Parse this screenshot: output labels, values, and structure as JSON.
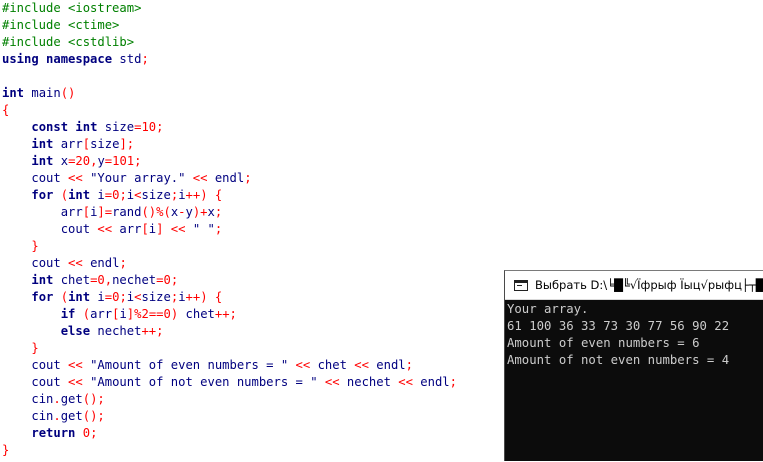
{
  "editor": {
    "lines": [
      [
        {
          "t": "#include <iostream>",
          "c": "pp"
        }
      ],
      [
        {
          "t": "#include <ctime>",
          "c": "pp"
        }
      ],
      [
        {
          "t": "#include <cstdlib>",
          "c": "pp"
        }
      ],
      [
        {
          "t": "using",
          "c": "kw"
        },
        {
          "t": " ",
          "c": ""
        },
        {
          "t": "namespace",
          "c": "kw"
        },
        {
          "t": " std",
          "c": "id"
        },
        {
          "t": ";",
          "c": "op"
        }
      ],
      [],
      [
        {
          "t": "int",
          "c": "kw"
        },
        {
          "t": " main",
          "c": "id"
        },
        {
          "t": "()",
          "c": "op"
        }
      ],
      [
        {
          "t": "{",
          "c": "op"
        }
      ],
      [
        {
          "t": "    ",
          "c": ""
        },
        {
          "t": "const",
          "c": "kw"
        },
        {
          "t": " ",
          "c": ""
        },
        {
          "t": "int",
          "c": "kw"
        },
        {
          "t": " size",
          "c": "id"
        },
        {
          "t": "=",
          "c": "op"
        },
        {
          "t": "10",
          "c": "num"
        },
        {
          "t": ";",
          "c": "op"
        }
      ],
      [
        {
          "t": "    ",
          "c": ""
        },
        {
          "t": "int",
          "c": "kw"
        },
        {
          "t": " arr",
          "c": "id"
        },
        {
          "t": "[",
          "c": "op"
        },
        {
          "t": "size",
          "c": "id"
        },
        {
          "t": "];",
          "c": "op"
        }
      ],
      [
        {
          "t": "    ",
          "c": ""
        },
        {
          "t": "int",
          "c": "kw"
        },
        {
          "t": " x",
          "c": "id"
        },
        {
          "t": "=",
          "c": "op"
        },
        {
          "t": "20",
          "c": "num"
        },
        {
          "t": ",",
          "c": "op"
        },
        {
          "t": "y",
          "c": "id"
        },
        {
          "t": "=",
          "c": "op"
        },
        {
          "t": "101",
          "c": "num"
        },
        {
          "t": ";",
          "c": "op"
        }
      ],
      [
        {
          "t": "    ",
          "c": ""
        },
        {
          "t": "cout",
          "c": "id"
        },
        {
          "t": " << ",
          "c": "op"
        },
        {
          "t": "\"Your array.\"",
          "c": "str"
        },
        {
          "t": " << ",
          "c": "op"
        },
        {
          "t": "endl",
          "c": "id"
        },
        {
          "t": ";",
          "c": "op"
        }
      ],
      [
        {
          "t": "    ",
          "c": ""
        },
        {
          "t": "for",
          "c": "kw"
        },
        {
          "t": " (",
          "c": "op"
        },
        {
          "t": "int",
          "c": "kw"
        },
        {
          "t": " i",
          "c": "id"
        },
        {
          "t": "=",
          "c": "op"
        },
        {
          "t": "0",
          "c": "num"
        },
        {
          "t": ";",
          "c": "op"
        },
        {
          "t": "i",
          "c": "id"
        },
        {
          "t": "<",
          "c": "op"
        },
        {
          "t": "size",
          "c": "id"
        },
        {
          "t": ";",
          "c": "op"
        },
        {
          "t": "i",
          "c": "id"
        },
        {
          "t": "++) {",
          "c": "op"
        }
      ],
      [
        {
          "t": "        ",
          "c": ""
        },
        {
          "t": "arr",
          "c": "id"
        },
        {
          "t": "[",
          "c": "op"
        },
        {
          "t": "i",
          "c": "id"
        },
        {
          "t": "]=",
          "c": "op"
        },
        {
          "t": "rand",
          "c": "id"
        },
        {
          "t": "()%(",
          "c": "op"
        },
        {
          "t": "x",
          "c": "id"
        },
        {
          "t": "-",
          "c": "op"
        },
        {
          "t": "y",
          "c": "id"
        },
        {
          "t": ")+",
          "c": "op"
        },
        {
          "t": "x",
          "c": "id"
        },
        {
          "t": ";",
          "c": "op"
        }
      ],
      [
        {
          "t": "        ",
          "c": ""
        },
        {
          "t": "cout",
          "c": "id"
        },
        {
          "t": " << ",
          "c": "op"
        },
        {
          "t": "arr",
          "c": "id"
        },
        {
          "t": "[",
          "c": "op"
        },
        {
          "t": "i",
          "c": "id"
        },
        {
          "t": "]",
          "c": "op"
        },
        {
          "t": " << ",
          "c": "op"
        },
        {
          "t": "\" \"",
          "c": "str"
        },
        {
          "t": ";",
          "c": "op"
        }
      ],
      [
        {
          "t": "    ",
          "c": ""
        },
        {
          "t": "}",
          "c": "op"
        }
      ],
      [
        {
          "t": "    ",
          "c": ""
        },
        {
          "t": "cout",
          "c": "id"
        },
        {
          "t": " << ",
          "c": "op"
        },
        {
          "t": "endl",
          "c": "id"
        },
        {
          "t": ";",
          "c": "op"
        }
      ],
      [
        {
          "t": "    ",
          "c": ""
        },
        {
          "t": "int",
          "c": "kw"
        },
        {
          "t": " chet",
          "c": "id"
        },
        {
          "t": "=",
          "c": "op"
        },
        {
          "t": "0",
          "c": "num"
        },
        {
          "t": ",",
          "c": "op"
        },
        {
          "t": "nechet",
          "c": "id"
        },
        {
          "t": "=",
          "c": "op"
        },
        {
          "t": "0",
          "c": "num"
        },
        {
          "t": ";",
          "c": "op"
        }
      ],
      [
        {
          "t": "    ",
          "c": ""
        },
        {
          "t": "for",
          "c": "kw"
        },
        {
          "t": " (",
          "c": "op"
        },
        {
          "t": "int",
          "c": "kw"
        },
        {
          "t": " i",
          "c": "id"
        },
        {
          "t": "=",
          "c": "op"
        },
        {
          "t": "0",
          "c": "num"
        },
        {
          "t": ";",
          "c": "op"
        },
        {
          "t": "i",
          "c": "id"
        },
        {
          "t": "<",
          "c": "op"
        },
        {
          "t": "size",
          "c": "id"
        },
        {
          "t": ";",
          "c": "op"
        },
        {
          "t": "i",
          "c": "id"
        },
        {
          "t": "++) {",
          "c": "op"
        }
      ],
      [
        {
          "t": "        ",
          "c": ""
        },
        {
          "t": "if",
          "c": "kw"
        },
        {
          "t": " (",
          "c": "op"
        },
        {
          "t": "arr",
          "c": "id"
        },
        {
          "t": "[",
          "c": "op"
        },
        {
          "t": "i",
          "c": "id"
        },
        {
          "t": "]%",
          "c": "op"
        },
        {
          "t": "2",
          "c": "num"
        },
        {
          "t": "==",
          "c": "op"
        },
        {
          "t": "0",
          "c": "num"
        },
        {
          "t": ")",
          "c": "op"
        },
        {
          "t": " chet",
          "c": "id"
        },
        {
          "t": "++;",
          "c": "op"
        }
      ],
      [
        {
          "t": "        ",
          "c": ""
        },
        {
          "t": "else",
          "c": "kw"
        },
        {
          "t": " nechet",
          "c": "id"
        },
        {
          "t": "++;",
          "c": "op"
        }
      ],
      [
        {
          "t": "    ",
          "c": ""
        },
        {
          "t": "}",
          "c": "op"
        }
      ],
      [
        {
          "t": "    ",
          "c": ""
        },
        {
          "t": "cout",
          "c": "id"
        },
        {
          "t": " << ",
          "c": "op"
        },
        {
          "t": "\"Amount of even numbers = \"",
          "c": "str"
        },
        {
          "t": " << ",
          "c": "op"
        },
        {
          "t": "chet",
          "c": "id"
        },
        {
          "t": " << ",
          "c": "op"
        },
        {
          "t": "endl",
          "c": "id"
        },
        {
          "t": ";",
          "c": "op"
        }
      ],
      [
        {
          "t": "    ",
          "c": ""
        },
        {
          "t": "cout",
          "c": "id"
        },
        {
          "t": " << ",
          "c": "op"
        },
        {
          "t": "\"Amount of not even numbers = \"",
          "c": "str"
        },
        {
          "t": " << ",
          "c": "op"
        },
        {
          "t": "nechet",
          "c": "id"
        },
        {
          "t": " << ",
          "c": "op"
        },
        {
          "t": "endl",
          "c": "id"
        },
        {
          "t": ";",
          "c": "op"
        }
      ],
      [
        {
          "t": "    ",
          "c": ""
        },
        {
          "t": "cin",
          "c": "id"
        },
        {
          "t": ".",
          "c": "op"
        },
        {
          "t": "get",
          "c": "id"
        },
        {
          "t": "();",
          "c": "op"
        }
      ],
      [
        {
          "t": "    ",
          "c": ""
        },
        {
          "t": "cin",
          "c": "id"
        },
        {
          "t": ".",
          "c": "op"
        },
        {
          "t": "get",
          "c": "id"
        },
        {
          "t": "();",
          "c": "op"
        }
      ],
      [
        {
          "t": "    ",
          "c": ""
        },
        {
          "t": "return",
          "c": "kw"
        },
        {
          "t": " ",
          "c": ""
        },
        {
          "t": "0",
          "c": "num"
        },
        {
          "t": ";",
          "c": "op"
        }
      ],
      [
        {
          "t": "}",
          "c": "op"
        }
      ]
    ]
  },
  "console": {
    "title": "Выбрать D:\\╘█╚√Ïфрыф Ïыц√рыфц├┬█",
    "icon": "console-window-icon",
    "output_lines": [
      "Your array.",
      "61 100 36 33 73 30 77 56 90 22",
      "Amount of even numbers = 6",
      "Amount of not even numbers = 4"
    ]
  },
  "colors": {
    "preprocessor": "#008000",
    "keyword": "#00007f",
    "identifier": "#000080",
    "number": "#ff0000",
    "operator": "#ff0000",
    "string": "#00007f",
    "console_background": "#0c0c0c",
    "console_text": "#cccccc"
  }
}
